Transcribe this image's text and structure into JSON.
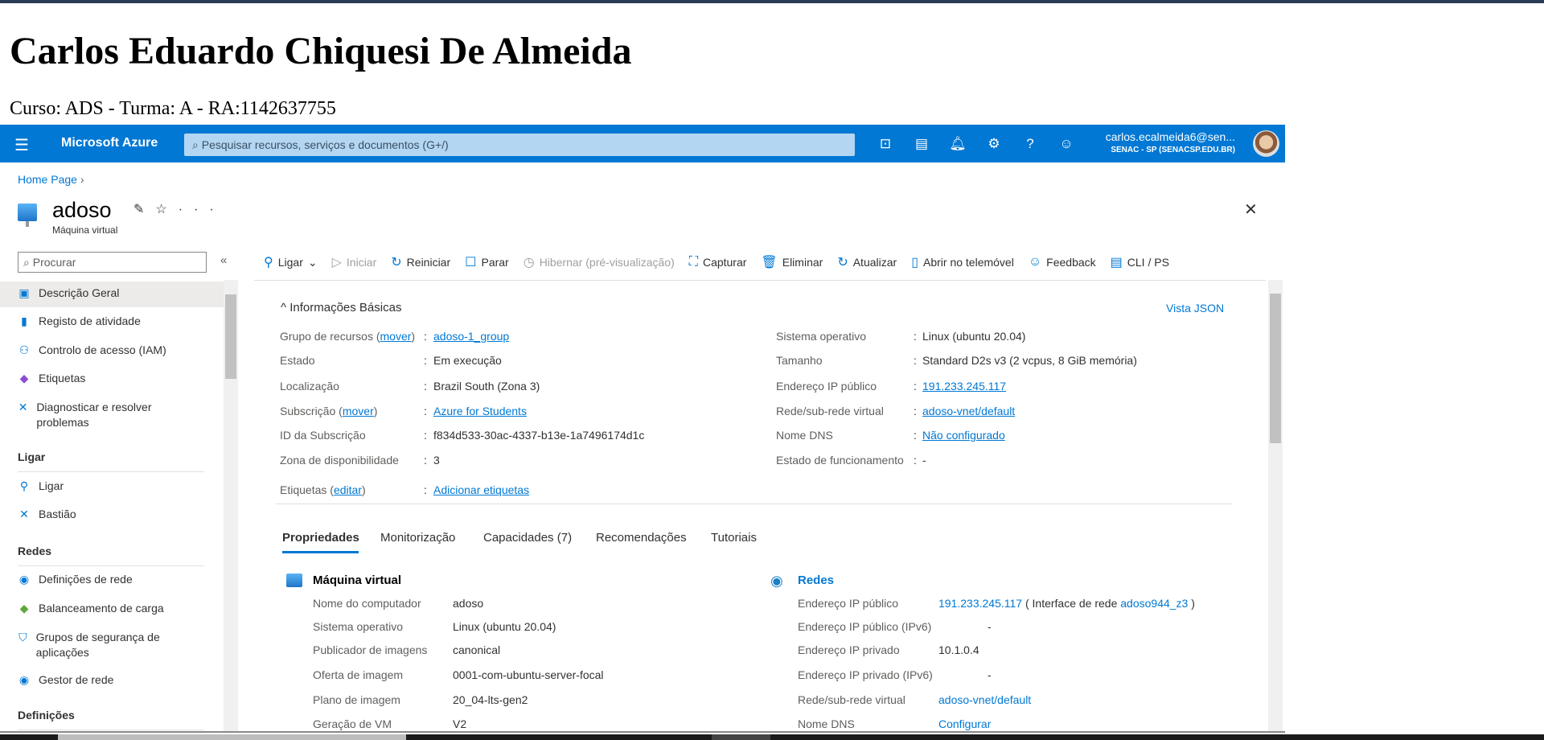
{
  "page": {
    "heading": "Carlos Eduardo Chiquesi De Almeida",
    "subtitle": "Curso: ADS - Turma: A - RA:1142637755"
  },
  "header": {
    "brand": "Microsoft Azure",
    "search_placeholder": "Pesquisar recursos, serviços e documentos (G+/)",
    "user": "carlos.ecalmeida6@sen...",
    "org": "SENAC - SP (SENACSP.EDU.BR)"
  },
  "breadcrumb": {
    "home": "Home Page"
  },
  "resource": {
    "name": "adoso",
    "type": "Máquina virtual"
  },
  "sidebar": {
    "search_placeholder": "Procurar",
    "collapse": "«",
    "items": [
      {
        "label": "Descrição Geral"
      },
      {
        "label": "Registo de atividade"
      },
      {
        "label": "Controlo de acesso (IAM)"
      },
      {
        "label": "Etiquetas"
      },
      {
        "label": "Diagnosticar e resolver problemas"
      }
    ],
    "sections": [
      {
        "title": "Ligar",
        "items": [
          {
            "label": "Ligar"
          },
          {
            "label": "Bastião"
          }
        ]
      },
      {
        "title": "Redes",
        "items": [
          {
            "label": "Definições de rede"
          },
          {
            "label": "Balanceamento de carga"
          },
          {
            "label": "Grupos de segurança de aplicações"
          },
          {
            "label": "Gestor de rede"
          }
        ]
      },
      {
        "title": "Definições",
        "items": []
      }
    ]
  },
  "toolbar": [
    "Ligar",
    "Iniciar",
    "Reiniciar",
    "Parar",
    "Hibernar (pré-visualização)",
    "Capturar",
    "Eliminar",
    "Atualizar",
    "Abrir no telemóvel",
    "Feedback",
    "CLI / PS"
  ],
  "essentials": {
    "title": "Informações Básicas",
    "json_view": "Vista JSON",
    "move": "mover",
    "edit": "editar",
    "left": [
      {
        "label": "Grupo de recursos",
        "value": "adoso-1_group"
      },
      {
        "label": "Estado",
        "value": "Em execução"
      },
      {
        "label": "Localização",
        "value": "Brazil South (Zona 3)"
      },
      {
        "label": "Subscrição",
        "value": "Azure for Students"
      },
      {
        "label": "ID da Subscrição",
        "value": "f834d533-30ac-4337-b13e-1a7496174d1c"
      },
      {
        "label": "Zona de disponibilidade",
        "value": "3"
      },
      {
        "label": "Etiquetas",
        "value": "Adicionar etiquetas"
      }
    ],
    "right": [
      {
        "label": "Sistema operativo",
        "value": "Linux (ubuntu 20.04)"
      },
      {
        "label": "Tamanho",
        "value": "Standard D2s v3 (2 vcpus, 8 GiB memória)"
      },
      {
        "label": "Endereço IP público",
        "value": "191.233.245.117"
      },
      {
        "label": "Rede/sub-rede virtual",
        "value": "adoso-vnet/default"
      },
      {
        "label": "Nome DNS",
        "value": "Não configurado"
      },
      {
        "label": "Estado de funcionamento",
        "value": "-"
      }
    ]
  },
  "tabs": [
    "Propriedades",
    "Monitorização",
    "Capacidades (7)",
    "Recomendações",
    "Tutoriais"
  ],
  "vm_props": {
    "title": "Máquina virtual",
    "rows": [
      {
        "label": "Nome do computador",
        "value": "adoso"
      },
      {
        "label": "Sistema operativo",
        "value": "Linux (ubuntu 20.04)"
      },
      {
        "label": "Publicador de imagens",
        "value": "canonical"
      },
      {
        "label": "Oferta de imagem",
        "value": "0001-com-ubuntu-server-focal"
      },
      {
        "label": "Plano de imagem",
        "value": "20_04-lts-gen2"
      },
      {
        "label": "Geração de VM",
        "value": "V2"
      }
    ]
  },
  "net_props": {
    "title": "Redes",
    "rows": [
      {
        "label": "Endereço IP público",
        "value": "191.233.245.117",
        "extra_pre": "( Interface de rede ",
        "extra_link": "adoso944_z3",
        "extra_post": " )"
      },
      {
        "label": "Endereço IP público (IPv6)",
        "value": "-"
      },
      {
        "label": "Endereço IP privado",
        "value": "10.1.0.4"
      },
      {
        "label": "Endereço IP privado (IPv6)",
        "value": "-"
      },
      {
        "label": "Rede/sub-rede virtual",
        "value": "adoso-vnet/default"
      },
      {
        "label": "Nome DNS",
        "value": "Configurar"
      }
    ]
  },
  "colors": {
    "azure_blue": "#0078d4"
  }
}
